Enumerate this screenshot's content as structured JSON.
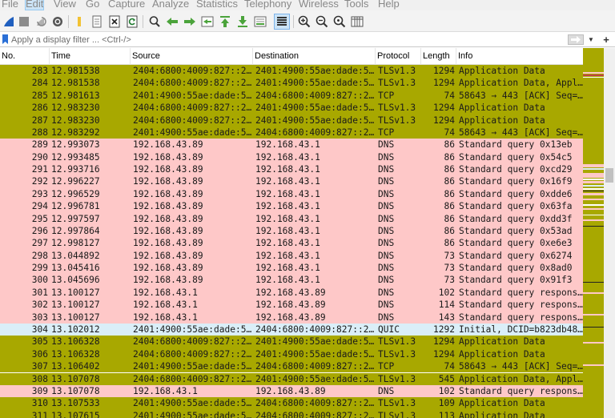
{
  "menu": {
    "items": [
      "File",
      "Edit",
      "View",
      "Go",
      "Capture",
      "Analyze",
      "Statistics",
      "Telephony",
      "Wireless",
      "Tools",
      "Help"
    ],
    "active": "Edit"
  },
  "toolbar": {
    "icons": [
      "shark-fin-icon",
      "stop-icon",
      "restart-icon",
      "options-gear-icon",
      "open-folder-icon",
      "save-file-icon",
      "close-file-icon",
      "reload-icon",
      "find-icon",
      "back-arrow-icon",
      "forward-arrow-icon",
      "go-to-packet-icon",
      "first-packet-icon",
      "last-packet-icon",
      "autoscroll-icon",
      "colorize-icon",
      "zoom-in-icon",
      "zoom-out-icon",
      "normal-size-icon",
      "resize-columns-icon"
    ]
  },
  "filter": {
    "placeholder": "Apply a display filter ... <Ctrl-/>",
    "value": ""
  },
  "columns": {
    "no": "No.",
    "time": "Time",
    "source": "Source",
    "destination": "Destination",
    "protocol": "Protocol",
    "length": "Length",
    "info": "Info"
  },
  "colors": {
    "tcp_tls": "#a8a800",
    "dns": "#fec8c8",
    "quic": "#daeef8"
  },
  "packets": [
    {
      "no": "283",
      "time": "12.981538",
      "src": "2404:6800:4009:827::2…",
      "dst": "2401:4900:55ae:dade:5…",
      "proto": "TLSv1.3",
      "len": "1294",
      "info": "Application Data",
      "cls": "tcp"
    },
    {
      "no": "284",
      "time": "12.981538",
      "src": "2404:6800:4009:827::2…",
      "dst": "2401:4900:55ae:dade:5…",
      "proto": "TLSv1.3",
      "len": "1294",
      "info": "Application Data, Appl…",
      "cls": "tcp"
    },
    {
      "no": "285",
      "time": "12.981613",
      "src": "2401:4900:55ae:dade:5…",
      "dst": "2404:6800:4009:827::2…",
      "proto": "TCP",
      "len": "74",
      "info": "58643 → 443 [ACK] Seq=…",
      "cls": "tcp"
    },
    {
      "no": "286",
      "time": "12.983230",
      "src": "2404:6800:4009:827::2…",
      "dst": "2401:4900:55ae:dade:5…",
      "proto": "TLSv1.3",
      "len": "1294",
      "info": "Application Data",
      "cls": "tcp"
    },
    {
      "no": "287",
      "time": "12.983230",
      "src": "2404:6800:4009:827::2…",
      "dst": "2401:4900:55ae:dade:5…",
      "proto": "TLSv1.3",
      "len": "1294",
      "info": "Application Data",
      "cls": "tcp"
    },
    {
      "no": "288",
      "time": "12.983292",
      "src": "2401:4900:55ae:dade:5…",
      "dst": "2404:6800:4009:827::2…",
      "proto": "TCP",
      "len": "74",
      "info": "58643 → 443 [ACK] Seq=…",
      "cls": "tcp"
    },
    {
      "no": "289",
      "time": "12.993073",
      "src": "192.168.43.89",
      "dst": "192.168.43.1",
      "proto": "DNS",
      "len": "86",
      "info": "Standard query 0x13eb",
      "cls": "dns"
    },
    {
      "no": "290",
      "time": "12.993485",
      "src": "192.168.43.89",
      "dst": "192.168.43.1",
      "proto": "DNS",
      "len": "86",
      "info": "Standard query 0x54c5",
      "cls": "dns"
    },
    {
      "no": "291",
      "time": "12.993716",
      "src": "192.168.43.89",
      "dst": "192.168.43.1",
      "proto": "DNS",
      "len": "86",
      "info": "Standard query 0xcd29",
      "cls": "dns"
    },
    {
      "no": "292",
      "time": "12.996227",
      "src": "192.168.43.89",
      "dst": "192.168.43.1",
      "proto": "DNS",
      "len": "86",
      "info": "Standard query 0x16f9",
      "cls": "dns"
    },
    {
      "no": "293",
      "time": "12.996529",
      "src": "192.168.43.89",
      "dst": "192.168.43.1",
      "proto": "DNS",
      "len": "86",
      "info": "Standard query 0xdde6",
      "cls": "dns"
    },
    {
      "no": "294",
      "time": "12.996781",
      "src": "192.168.43.89",
      "dst": "192.168.43.1",
      "proto": "DNS",
      "len": "86",
      "info": "Standard query 0x63fa",
      "cls": "dns"
    },
    {
      "no": "295",
      "time": "12.997597",
      "src": "192.168.43.89",
      "dst": "192.168.43.1",
      "proto": "DNS",
      "len": "86",
      "info": "Standard query 0xdd3f",
      "cls": "dns"
    },
    {
      "no": "296",
      "time": "12.997864",
      "src": "192.168.43.89",
      "dst": "192.168.43.1",
      "proto": "DNS",
      "len": "86",
      "info": "Standard query 0x53ad",
      "cls": "dns"
    },
    {
      "no": "297",
      "time": "12.998127",
      "src": "192.168.43.89",
      "dst": "192.168.43.1",
      "proto": "DNS",
      "len": "86",
      "info": "Standard query 0xe6e3",
      "cls": "dns"
    },
    {
      "no": "298",
      "time": "13.044892",
      "src": "192.168.43.89",
      "dst": "192.168.43.1",
      "proto": "DNS",
      "len": "73",
      "info": "Standard query 0x6274",
      "cls": "dns"
    },
    {
      "no": "299",
      "time": "13.045416",
      "src": "192.168.43.89",
      "dst": "192.168.43.1",
      "proto": "DNS",
      "len": "73",
      "info": "Standard query 0x8ad0",
      "cls": "dns"
    },
    {
      "no": "300",
      "time": "13.045696",
      "src": "192.168.43.89",
      "dst": "192.168.43.1",
      "proto": "DNS",
      "len": "73",
      "info": "Standard query 0x91f3",
      "cls": "dns"
    },
    {
      "no": "301",
      "time": "13.100127",
      "src": "192.168.43.1",
      "dst": "192.168.43.89",
      "proto": "DNS",
      "len": "102",
      "info": "Standard query respons…",
      "cls": "dns"
    },
    {
      "no": "302",
      "time": "13.100127",
      "src": "192.168.43.1",
      "dst": "192.168.43.89",
      "proto": "DNS",
      "len": "114",
      "info": "Standard query respons…",
      "cls": "dns"
    },
    {
      "no": "303",
      "time": "13.100127",
      "src": "192.168.43.1",
      "dst": "192.168.43.89",
      "proto": "DNS",
      "len": "143",
      "info": "Standard query respons…",
      "cls": "dns"
    },
    {
      "no": "304",
      "time": "13.102012",
      "src": "2401:4900:55ae:dade:5…",
      "dst": "2404:6800:4009:827::2…",
      "proto": "QUIC",
      "len": "1292",
      "info": "Initial, DCID=b823db48…",
      "cls": "quic"
    },
    {
      "no": "305",
      "time": "13.106328",
      "src": "2404:6800:4009:827::2…",
      "dst": "2401:4900:55ae:dade:5…",
      "proto": "TLSv1.3",
      "len": "1294",
      "info": "Application Data",
      "cls": "tcp"
    },
    {
      "no": "306",
      "time": "13.106328",
      "src": "2404:6800:4009:827::2…",
      "dst": "2401:4900:55ae:dade:5…",
      "proto": "TLSv1.3",
      "len": "1294",
      "info": "Application Data",
      "cls": "tcp"
    },
    {
      "no": "307",
      "time": "13.106402",
      "src": "2401:4900:55ae:dade:5…",
      "dst": "2404:6800:4009:827::2…",
      "proto": "TCP",
      "len": "74",
      "info": "58643 → 443 [ACK] Seq=…",
      "cls": "tcp"
    },
    {
      "no": "308",
      "time": "13.107078",
      "src": "2404:6800:4009:827::2…",
      "dst": "2401:4900:55ae:dade:5…",
      "proto": "TLSv1.3",
      "len": "545",
      "info": "Application Data, Appl…",
      "cls": "tcp"
    },
    {
      "no": "309",
      "time": "13.107078",
      "src": "192.168.43.1",
      "dst": "192.168.43.89",
      "proto": "DNS",
      "len": "102",
      "info": "Standard query respons…",
      "cls": "dns"
    },
    {
      "no": "310",
      "time": "13.107533",
      "src": "2401:4900:55ae:dade:5…",
      "dst": "2404:6800:4009:827::2…",
      "proto": "TLSv1.3",
      "len": "109",
      "info": "Application Data",
      "cls": "tcp"
    },
    {
      "no": "311",
      "time": "13.107615",
      "src": "2401:4900:55ae:dade:5…",
      "dst": "2404:6800:4009:827::2…",
      "proto": "TLSv1.3",
      "len": "113",
      "info": "Application Data",
      "cls": "tcp"
    }
  ]
}
